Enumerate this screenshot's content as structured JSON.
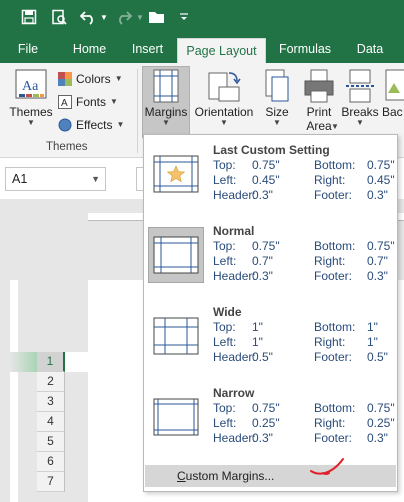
{
  "quick_access": {
    "icons": [
      "save-icon",
      "print-preview-icon",
      "undo-icon",
      "redo-icon",
      "open-folder-icon",
      "customize-icon"
    ]
  },
  "ribbon_tabs": [
    "File",
    "Home",
    "Insert",
    "Page Layout",
    "Formulas",
    "Data"
  ],
  "active_tab": "Page Layout",
  "themes_group": {
    "themes_label": "Themes",
    "colors_label": "Colors",
    "fonts_label": "Fonts",
    "effects_label": "Effects",
    "group_label": "Themes"
  },
  "page_setup": {
    "margins_label": "Margins",
    "orientation_label": "Orientation",
    "size_label": "Size",
    "print_area_label": [
      "Print",
      "Area"
    ],
    "breaks_label": "Breaks",
    "background_label": "Bac"
  },
  "name_box": "A1",
  "row_headers": [
    "1",
    "2",
    "3",
    "4",
    "5",
    "6",
    "7"
  ],
  "margin_options": [
    {
      "title": "Last Custom Setting",
      "rows": [
        [
          "Top:",
          "0.75\"",
          "Bottom:",
          "0.75\""
        ],
        [
          "Left:",
          "0.45\"",
          "Right:",
          "0.45\""
        ],
        [
          "Header:",
          "0.3\"",
          "Footer:",
          "0.3\""
        ]
      ]
    },
    {
      "title": "Normal",
      "rows": [
        [
          "Top:",
          "0.75\"",
          "Bottom:",
          "0.75\""
        ],
        [
          "Left:",
          "0.7\"",
          "Right:",
          "0.7\""
        ],
        [
          "Header:",
          "0.3\"",
          "Footer:",
          "0.3\""
        ]
      ]
    },
    {
      "title": "Wide",
      "rows": [
        [
          "Top:",
          "1\"",
          "Bottom:",
          "1\""
        ],
        [
          "Left:",
          "1\"",
          "Right:",
          "1\""
        ],
        [
          "Header:",
          "0.5\"",
          "Footer:",
          "0.5\""
        ]
      ]
    },
    {
      "title": "Narrow",
      "rows": [
        [
          "Top:",
          "0.75\"",
          "Bottom:",
          "0.75\""
        ],
        [
          "Left:",
          "0.25\"",
          "Right:",
          "0.25\""
        ],
        [
          "Header:",
          "0.3\"",
          "Footer:",
          "0.3\""
        ]
      ]
    }
  ],
  "custom_margins": {
    "underlined": "C",
    "rest": "ustom Margins..."
  },
  "colors": {
    "excel_green": "#217346",
    "annotation": "#e0202a"
  }
}
